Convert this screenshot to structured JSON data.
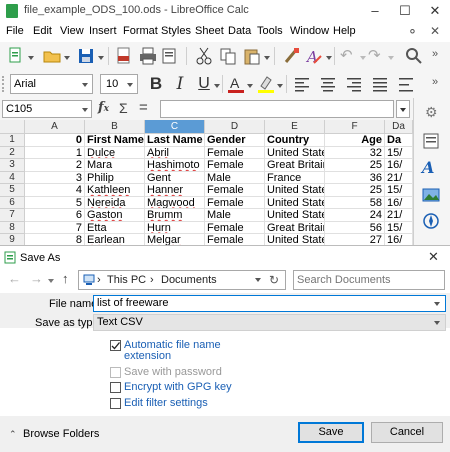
{
  "window": {
    "title": "file_example_ODS_100.ods - LibreOffice Calc"
  },
  "menu": [
    "File",
    "Edit",
    "View",
    "Insert",
    "Format",
    "Styles",
    "Sheet",
    "Data",
    "Tools",
    "Window",
    "Help"
  ],
  "formatting": {
    "font_name": "Arial",
    "font_size": "10"
  },
  "formula_bar": {
    "cell_ref": "C105",
    "content": ""
  },
  "sheet": {
    "columns": [
      "A",
      "B",
      "C",
      "D",
      "E",
      "F",
      "Da"
    ],
    "selected_column": "C",
    "rows": [
      {
        "n": "1",
        "a": "0",
        "b": "First Name",
        "c": "Last Name",
        "d": "Gender",
        "e": "Country",
        "f": "Age",
        "g": "Da"
      },
      {
        "n": "2",
        "a": "1",
        "b": "Dulce",
        "c": "Abril",
        "d": "Female",
        "e": "United States",
        "f": "32",
        "g": "15/"
      },
      {
        "n": "3",
        "a": "2",
        "b": "Mara",
        "c": "Hashimoto",
        "d": "Female",
        "e": "Great Britain",
        "f": "25",
        "g": "16/"
      },
      {
        "n": "4",
        "a": "3",
        "b": "Philip",
        "c": "Gent",
        "d": "Male",
        "e": "France",
        "f": "36",
        "g": "21/"
      },
      {
        "n": "5",
        "a": "4",
        "b": "Kathleen",
        "c": "Hanner",
        "d": "Female",
        "e": "United States",
        "f": "25",
        "g": "15/"
      },
      {
        "n": "6",
        "a": "5",
        "b": "Nereida",
        "c": "Magwood",
        "d": "Female",
        "e": "United States",
        "f": "58",
        "g": "16/"
      },
      {
        "n": "7",
        "a": "6",
        "b": "Gaston",
        "c": "Brumm",
        "d": "Male",
        "e": "United States",
        "f": "24",
        "g": "21/"
      },
      {
        "n": "8",
        "a": "7",
        "b": "Etta",
        "c": "Hurn",
        "d": "Female",
        "e": "Great Britain",
        "f": "56",
        "g": "15/"
      },
      {
        "n": "9",
        "a": "8",
        "b": "Earlean",
        "c": "Melgar",
        "d": "Female",
        "e": "United States",
        "f": "27",
        "g": "16/"
      }
    ]
  },
  "dialog": {
    "title": "Save As",
    "breadcrumb": [
      "This PC",
      "Documents"
    ],
    "search_placeholder": "Search Documents",
    "file_name_label": "File name:",
    "file_name_value": "list of freeware",
    "save_as_type_label": "Save as type:",
    "save_as_type_value": "Text CSV",
    "options": [
      {
        "label": "Automatic file name",
        "label2": "extension",
        "checked": true,
        "disabled": false
      },
      {
        "label": "Save with password",
        "checked": false,
        "disabled": true
      },
      {
        "label": "Encrypt with GPG key",
        "checked": false,
        "disabled": false
      },
      {
        "label": "Edit filter settings",
        "checked": false,
        "disabled": false
      }
    ],
    "browse_folders": "Browse Folders",
    "save_button": "Save",
    "cancel_button": "Cancel"
  },
  "colors": {
    "accent": "#0078d7",
    "selected_header": "#5b9bd5",
    "calc_green": "#2e9e4b",
    "link_blue": "#1a5fb4"
  }
}
